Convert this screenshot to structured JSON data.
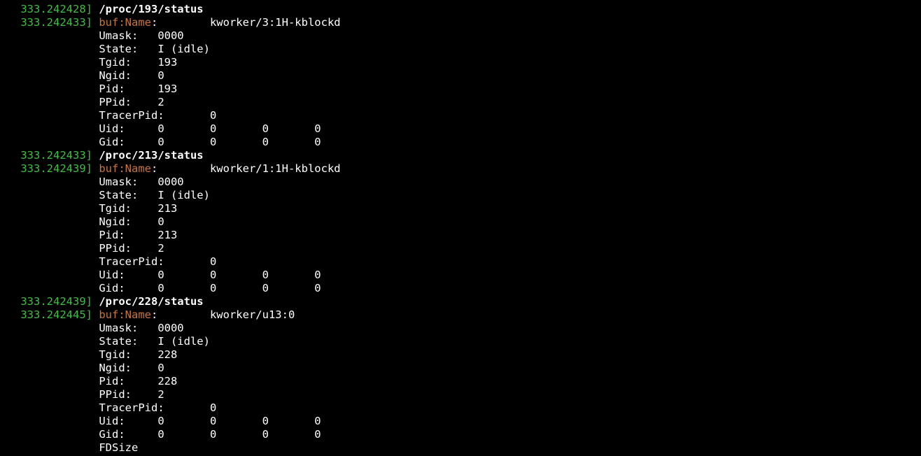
{
  "terminal": {
    "lines": [
      {
        "ts": " 333.242428] ",
        "kind": "path",
        "text": "/proc/193/status"
      },
      {
        "ts": " 333.242433] ",
        "kind": "buf",
        "label": "buf:Name",
        "text": ":        kworker/3:1H-kblockd"
      },
      {
        "ts": "             ",
        "kind": "plain",
        "text": "Umask:   0000"
      },
      {
        "ts": "             ",
        "kind": "plain",
        "text": "State:   I (idle)"
      },
      {
        "ts": "             ",
        "kind": "plain",
        "text": "Tgid:    193"
      },
      {
        "ts": "             ",
        "kind": "plain",
        "text": "Ngid:    0"
      },
      {
        "ts": "             ",
        "kind": "plain",
        "text": "Pid:     193"
      },
      {
        "ts": "             ",
        "kind": "plain",
        "text": "PPid:    2"
      },
      {
        "ts": "             ",
        "kind": "plain",
        "text": "TracerPid:       0"
      },
      {
        "ts": "             ",
        "kind": "plain",
        "text": "Uid:     0       0       0       0"
      },
      {
        "ts": "             ",
        "kind": "plain",
        "text": "Gid:     0       0       0       0"
      },
      {
        "ts": " 333.242433] ",
        "kind": "path",
        "text": "/proc/213/status"
      },
      {
        "ts": " 333.242439] ",
        "kind": "buf",
        "label": "buf:Name",
        "text": ":        kworker/1:1H-kblockd"
      },
      {
        "ts": "             ",
        "kind": "plain",
        "text": "Umask:   0000"
      },
      {
        "ts": "             ",
        "kind": "plain",
        "text": "State:   I (idle)"
      },
      {
        "ts": "             ",
        "kind": "plain",
        "text": "Tgid:    213"
      },
      {
        "ts": "             ",
        "kind": "plain",
        "text": "Ngid:    0"
      },
      {
        "ts": "             ",
        "kind": "plain",
        "text": "Pid:     213"
      },
      {
        "ts": "             ",
        "kind": "plain",
        "text": "PPid:    2"
      },
      {
        "ts": "             ",
        "kind": "plain",
        "text": "TracerPid:       0"
      },
      {
        "ts": "             ",
        "kind": "plain",
        "text": "Uid:     0       0       0       0"
      },
      {
        "ts": "             ",
        "kind": "plain",
        "text": "Gid:     0       0       0       0"
      },
      {
        "ts": " 333.242439] ",
        "kind": "path",
        "text": "/proc/228/status"
      },
      {
        "ts": " 333.242445] ",
        "kind": "buf",
        "label": "buf:Name",
        "text": ":        kworker/u13:0"
      },
      {
        "ts": "             ",
        "kind": "plain",
        "text": "Umask:   0000"
      },
      {
        "ts": "             ",
        "kind": "plain",
        "text": "State:   I (idle)"
      },
      {
        "ts": "             ",
        "kind": "plain",
        "text": "Tgid:    228"
      },
      {
        "ts": "             ",
        "kind": "plain",
        "text": "Ngid:    0"
      },
      {
        "ts": "             ",
        "kind": "plain",
        "text": "Pid:     228"
      },
      {
        "ts": "             ",
        "kind": "plain",
        "text": "PPid:    2"
      },
      {
        "ts": "             ",
        "kind": "plain",
        "text": "TracerPid:       0"
      },
      {
        "ts": "             ",
        "kind": "plain",
        "text": "Uid:     0       0       0       0"
      },
      {
        "ts": "             ",
        "kind": "plain",
        "text": "Gid:     0       0       0       0"
      },
      {
        "ts": "             ",
        "kind": "plain",
        "text": "FDSize"
      }
    ]
  },
  "colors": {
    "background": "#000000",
    "timestamp": "#3fbf3f",
    "buf_label": "#c8743c",
    "text": "#ffffff"
  }
}
